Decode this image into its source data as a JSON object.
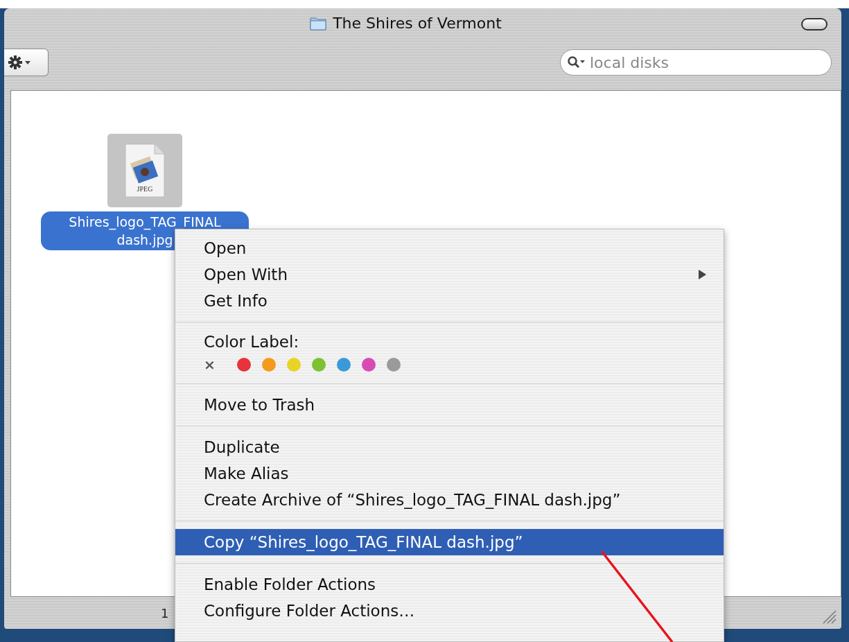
{
  "window": {
    "title": "The Shires of Vermont"
  },
  "toolbar": {
    "search": {
      "placeholder": "local disks"
    }
  },
  "files": [
    {
      "name": "Shires_logo_TAG_FINAL dash.jpg",
      "badge": "JPEG",
      "selected": true
    }
  ],
  "status_bar": {
    "text": "1"
  },
  "context_menu": {
    "items": [
      {
        "kind": "item",
        "label": "Open",
        "selected": false,
        "has_submenu": false
      },
      {
        "kind": "item",
        "label": "Open With",
        "selected": false,
        "has_submenu": true
      },
      {
        "kind": "item",
        "label": "Get Info",
        "selected": false,
        "has_submenu": false
      },
      {
        "kind": "separator"
      },
      {
        "kind": "color_label",
        "label": "Color Label:",
        "clear": "×",
        "colors": [
          {
            "color": "#e8323c"
          },
          {
            "color": "#f59a1e"
          },
          {
            "color": "#e8d424"
          },
          {
            "color": "#7cc232"
          },
          {
            "color": "#3a9ad8"
          },
          {
            "color": "#d64cb4"
          },
          {
            "color": "#9a9a9a"
          }
        ]
      },
      {
        "kind": "separator"
      },
      {
        "kind": "item",
        "label": "Move to Trash",
        "selected": false,
        "has_submenu": false
      },
      {
        "kind": "separator"
      },
      {
        "kind": "item",
        "label": "Duplicate",
        "selected": false,
        "has_submenu": false
      },
      {
        "kind": "item",
        "label": "Make Alias",
        "selected": false,
        "has_submenu": false
      },
      {
        "kind": "item",
        "label": "Create Archive of “Shires_logo_TAG_FINAL dash.jpg”",
        "selected": false,
        "has_submenu": false
      },
      {
        "kind": "separator"
      },
      {
        "kind": "item",
        "label": "Copy “Shires_logo_TAG_FINAL dash.jpg”",
        "selected": true,
        "has_submenu": false
      },
      {
        "kind": "separator"
      },
      {
        "kind": "item",
        "label": "Enable Folder Actions",
        "selected": false,
        "has_submenu": false
      },
      {
        "kind": "item",
        "label": "Configure Folder Actions…",
        "selected": false,
        "has_submenu": false
      }
    ]
  }
}
